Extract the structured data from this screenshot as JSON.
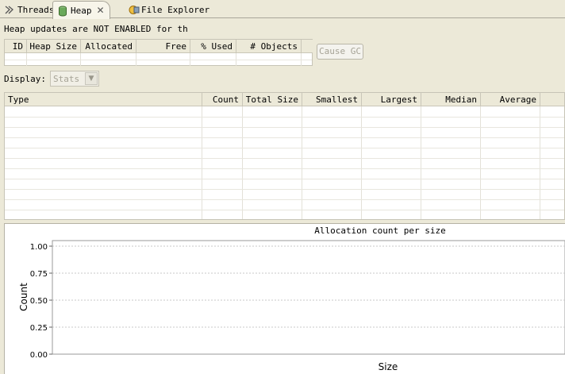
{
  "tabs": [
    {
      "label": "Threads",
      "icon": "threads-icon"
    },
    {
      "label": "Heap",
      "icon": "heap-icon",
      "active": true
    },
    {
      "label": "File Explorer",
      "icon": "file-explorer-icon"
    }
  ],
  "message": "Heap updates are NOT ENABLED for th",
  "heap_table": {
    "columns": [
      "ID",
      "Heap Size",
      "Allocated",
      "Free",
      "% Used",
      "# Objects"
    ]
  },
  "cause_gc_label": "Cause GC",
  "display": {
    "label": "Display:",
    "value": "Stats"
  },
  "stats_table": {
    "columns": [
      "Type",
      "Count",
      "Total Size",
      "Smallest",
      "Largest",
      "Median",
      "Average"
    ]
  },
  "chart_data": {
    "type": "bar",
    "title": "Allocation count per size",
    "xlabel": "Size",
    "ylabel": "Count",
    "yticks": [
      "1.00",
      "0.75",
      "0.50",
      "0.25",
      "0.00"
    ],
    "ylim": [
      0,
      1
    ],
    "grid": true,
    "series": []
  }
}
